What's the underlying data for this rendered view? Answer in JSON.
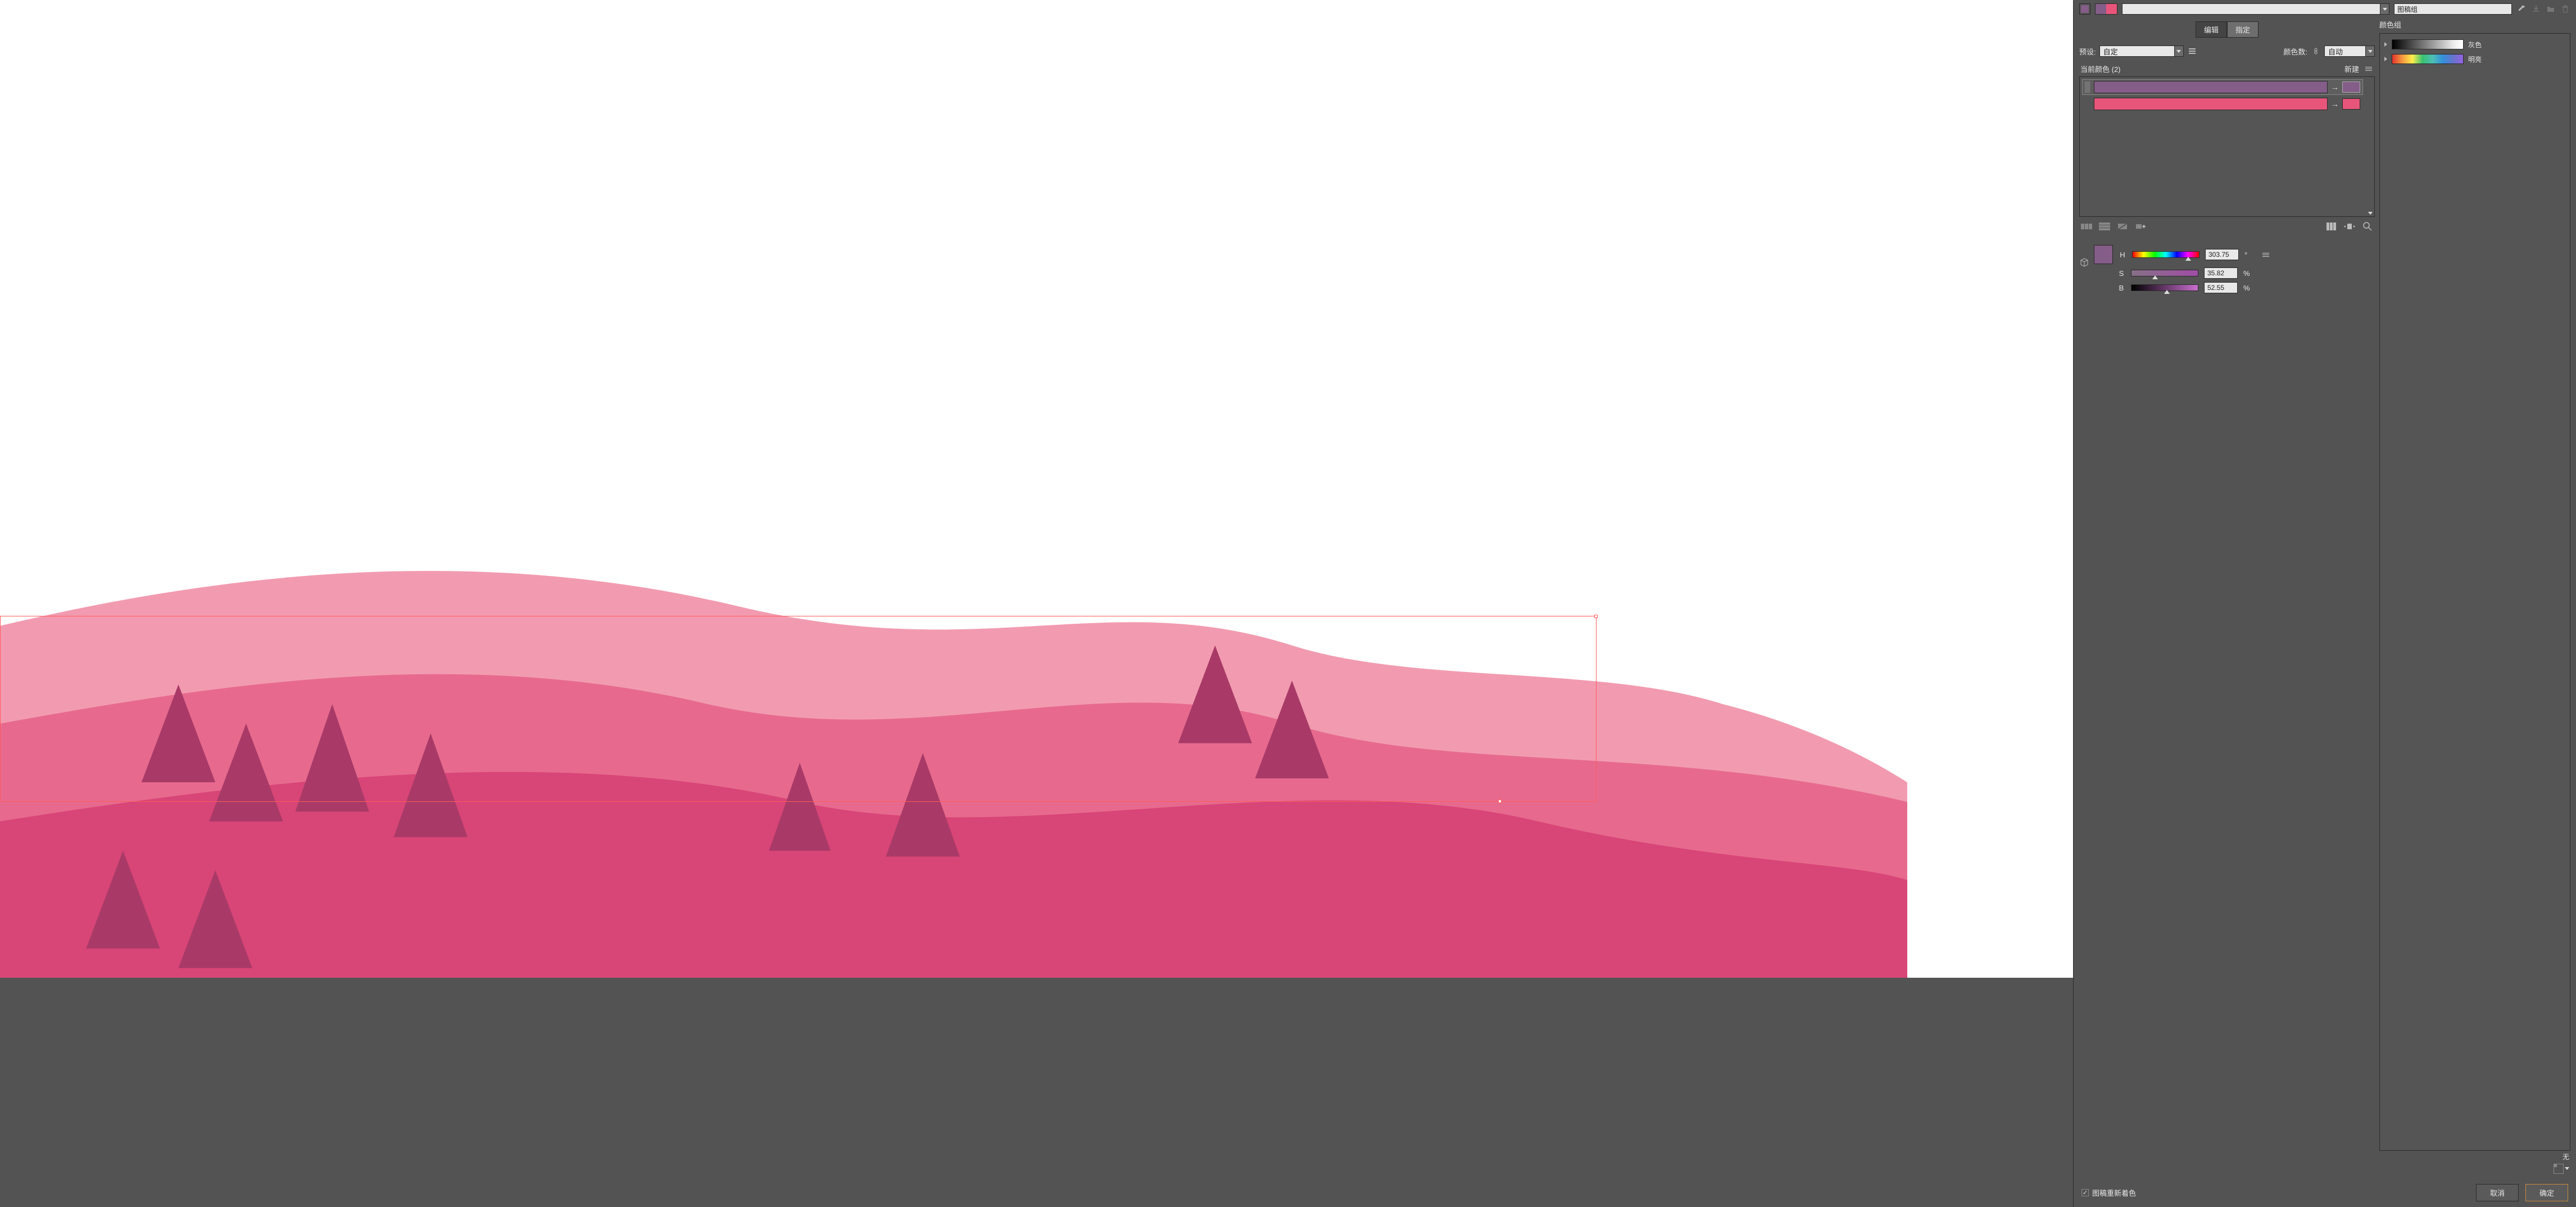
{
  "topbar": {
    "swatch_main_color": "#845d88",
    "pair_colors": [
      "#845d88",
      "#e8557b"
    ],
    "group_input": "图稿组"
  },
  "tabs": {
    "edit": "编辑",
    "assign": "指定",
    "active": "assign"
  },
  "preset": {
    "label": "预设:",
    "value": "自定",
    "count_label": "颜色数:",
    "count_value": "自动"
  },
  "color_list": {
    "header": "当前颜色 (2)",
    "new_label": "新建",
    "rows": [
      {
        "from": "#845d88",
        "to": "#845d88",
        "selected": true
      },
      {
        "from": "#e8557b",
        "to": "#e8557b",
        "selected": false
      }
    ]
  },
  "hsb": {
    "swatch": "#845d88",
    "h": {
      "label": "H",
      "value": "303.75",
      "unit": "°",
      "thumb_pct": 84
    },
    "s": {
      "label": "S",
      "value": "35.82",
      "unit": "%",
      "thumb_pct": 36
    },
    "b": {
      "label": "B",
      "value": "52.55",
      "unit": "%",
      "thumb_pct": 53
    }
  },
  "groups": {
    "header": "颜色组",
    "items": [
      {
        "label": "灰色",
        "type": "gray"
      },
      {
        "label": "明亮",
        "type": "bright"
      }
    ],
    "none": "无"
  },
  "footer": {
    "recolor_checkbox": "图稿重新着色",
    "recolor_checked": true,
    "cancel": "取消",
    "ok": "确定"
  },
  "icons": {
    "eyedropper": "eyedropper-icon",
    "download": "download-icon",
    "folder": "folder-icon",
    "trash": "trash-icon",
    "list": "list-icon",
    "link": "link-icon",
    "arrange_h": "arrange-h-icon",
    "arrange_v": "arrange-v-icon",
    "unlink": "unlink-icon",
    "add": "add-icon",
    "cols": "columns-icon",
    "expand_h": "expand-h-icon",
    "magnify": "magnify-icon",
    "menu": "menu-icon",
    "pos_grid": "position-grid-icon",
    "cube": "cube-icon"
  }
}
